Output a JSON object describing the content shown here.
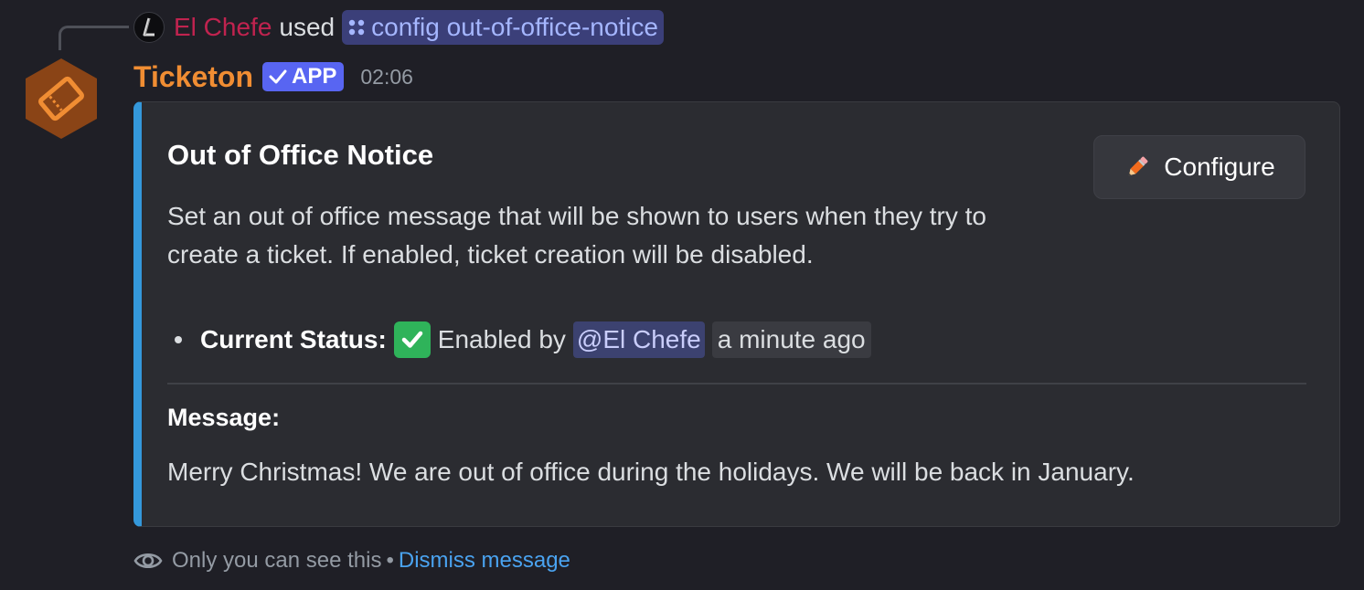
{
  "interaction": {
    "user": "El Chefe",
    "verb": "used",
    "command": "config out-of-office-notice"
  },
  "message": {
    "author": "Ticketon",
    "badge": "APP",
    "timestamp": "02:06"
  },
  "embed": {
    "accent_color": "#3498db",
    "title": "Out of Office Notice",
    "description": "Set an out of office message that will be shown to users when they try to create a ticket. If enabled, ticket creation will be disabled.",
    "configure_button": {
      "label": "Configure",
      "icon": "pencil-icon"
    },
    "status": {
      "label": "Current Status:",
      "icon": "check-mark-button-icon",
      "text": "Enabled by",
      "mention": "@El Chefe",
      "relative_time": "a minute ago"
    },
    "message_label": "Message:",
    "message_text": "Merry Christmas! We are out of office during the holidays. We will be back in January."
  },
  "footer": {
    "icon": "eye-icon",
    "notice": "Only you can see this",
    "separator": "•",
    "dismiss": "Dismiss message"
  },
  "colors": {
    "background": "#1f1f26",
    "author": "#f08d33",
    "interaction_user": "#c0234f",
    "app_badge": "#5865f2",
    "link": "#4aa3f0"
  }
}
